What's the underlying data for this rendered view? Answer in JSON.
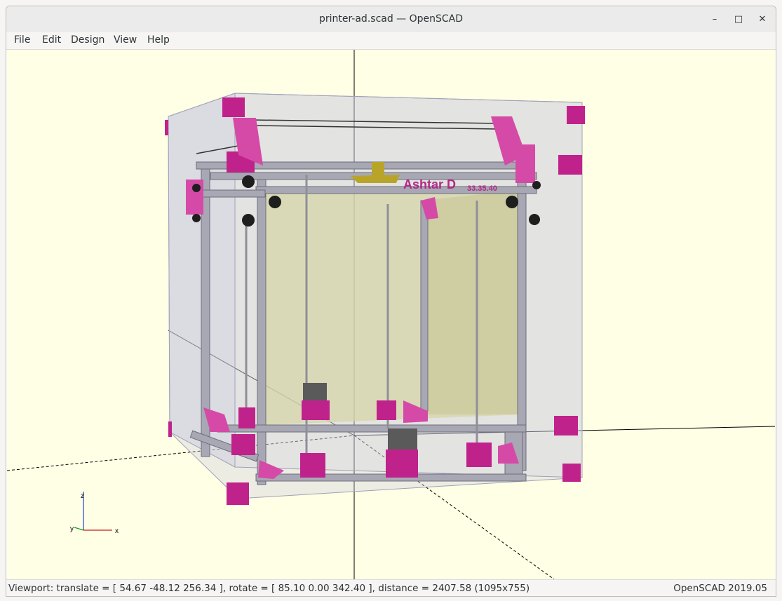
{
  "window": {
    "title": "printer-ad.scad — OpenSCAD",
    "minimize_glyph": "–",
    "maximize_glyph": "□",
    "close_glyph": "✕"
  },
  "menu": [
    {
      "label": "File"
    },
    {
      "label": "Edit"
    },
    {
      "label": "Design"
    },
    {
      "label": "View"
    },
    {
      "label": "Help"
    }
  ],
  "viewport": {
    "model_label": "Ashtar D",
    "model_sublabel": "33.35.40",
    "axes": {
      "x": "x",
      "y": "y",
      "z": "z"
    },
    "colors": {
      "background": "#ffffe5",
      "frame": "#a8a8b4",
      "brackets": "#c0228c",
      "enclosure": "#c8c8e0",
      "bed": "#d7d6a8"
    }
  },
  "status": {
    "viewport_info": "Viewport: translate = [ 54.67 -48.12 256.34 ], rotate = [ 85.10 0.00 342.40 ], distance = 2407.58 (1095x755)",
    "version": "OpenSCAD 2019.05"
  }
}
